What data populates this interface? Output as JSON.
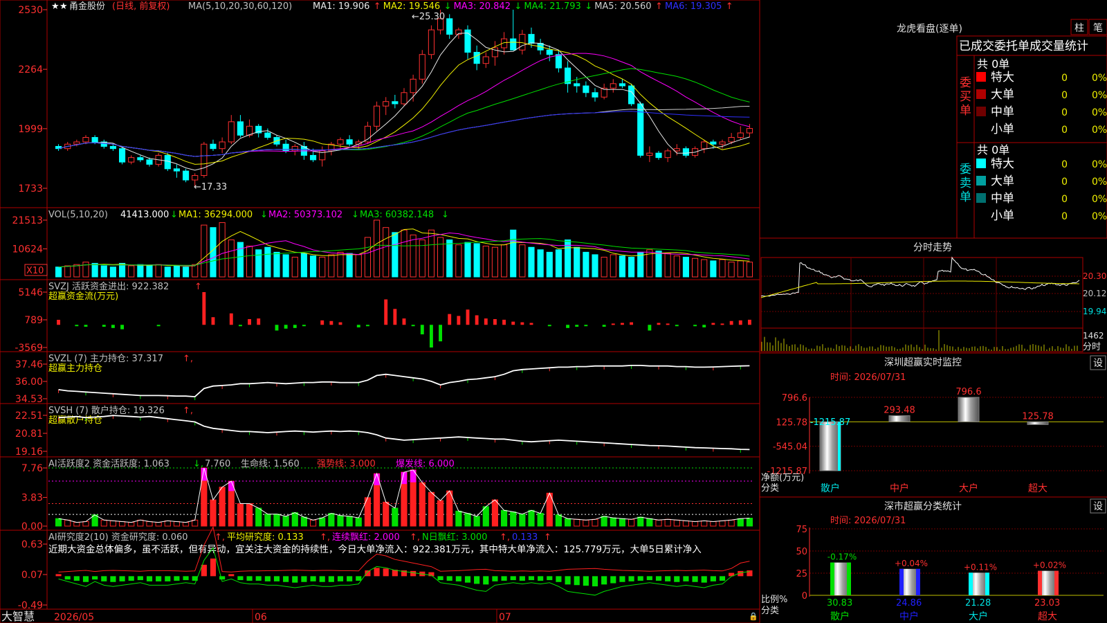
{
  "header": {
    "stock_name": "甬金股份",
    "mode": "(日线, 前复权)",
    "ma_label": "MA(5,10,20,30,60,120)",
    "ma_values": [
      {
        "label": "MA1: 19.906",
        "arrow": "↑",
        "color": "#e8e8e8"
      },
      {
        "label": "MA2: 19.546",
        "arrow": "↓",
        "color": "#f0f000"
      },
      {
        "label": "MA3: 20.842",
        "arrow": "↓",
        "color": "#ff00ff"
      },
      {
        "label": "MA4: 21.793",
        "arrow": "↓",
        "color": "#00e000"
      },
      {
        "label": "MA5: 20.560",
        "arrow": "↑",
        "color": "#d0d0d0"
      },
      {
        "label": "MA6: 19.305",
        "arrow": "↑",
        "color": "#3030ff"
      }
    ]
  },
  "price_axis": [
    "2530",
    "2264",
    "1999",
    "1733"
  ],
  "annotations": {
    "high": "25.30",
    "low": "17.33"
  },
  "vol_panel": {
    "title": "VOL(5,10,20)",
    "value": "41413.000",
    "ma1": "MA1: 36294.000",
    "ma2": "MA2: 50373.102",
    "ma3": "MA3: 60382.148",
    "axis": [
      "21513",
      "10624"
    ],
    "unit": "X10"
  },
  "svzj_panel": {
    "title": "SVZJ  活跃资金进出: 922.382",
    "subtitle": "超赢资金流(万元)",
    "axis": [
      "5146",
      "789",
      "-3569"
    ]
  },
  "svzl_panel": {
    "title": "SVZL (7) 主力持仓: 37.317",
    "subtitle": "超赢主力持仓",
    "axis": [
      "37.46",
      "36.00",
      "34.53"
    ]
  },
  "svsh_panel": {
    "title": "SVSH (7) 散户持仓: 19.326",
    "subtitle": "超赢散户持仓",
    "axis": [
      "22.51",
      "20.81",
      "19.16"
    ]
  },
  "ai_panel": {
    "title": "AI活跃度2 资金活跃度: 1.063",
    "v2": "7.760",
    "life": "生命线: 1.560",
    "strong": "强势线: 3.000",
    "burst": "爆发线: 6.000",
    "axis": [
      "7.76",
      "3.83",
      "0.00"
    ]
  },
  "research_panel": {
    "title": "AI研究度2(10) 资金研究度: 0.060",
    "avg": "平均研究度: 0.133",
    "red": "连续飘红: 2.000",
    "nred": "N日飘红: 3.000",
    "last": "0.133",
    "text": "近期大资金总体偏多，虽不活跃，但有异动，宜关注大资金的持续性，今日大单净流入：922.381万元，其中特大单净流入：125.779万元，大单5日累计净入",
    "axis": [
      "0.63",
      "0.07",
      "-0.49"
    ]
  },
  "footer": {
    "brand": "大智慧",
    "dates": [
      "2026/05",
      "06",
      "07"
    ]
  },
  "right": {
    "lhb_title": "龙虎看盘(逐单)",
    "btn_bar": "柱",
    "btn_pen": "笔",
    "trade_header": "已成交委托单成交量统计",
    "buy_label": "委买单",
    "sell_label": "委卖单",
    "buy_total": "共 0单",
    "sell_total": "共 0单",
    "rows": [
      "特大",
      "大单",
      "中单",
      "小单"
    ],
    "zero": "0",
    "pct": "0%",
    "fenshi_title": "分时走势",
    "fenshi_axis": [
      "20.30",
      "20.12",
      "19.94"
    ],
    "fenshi_vol": "1462",
    "fenshi_unit": "分时",
    "sz_title": "深圳超赢实时监控",
    "sz_setting": "设",
    "sz_time": "时间: 2026/07/31",
    "sz_axis": [
      "796.6",
      "125.78",
      "-545.04",
      "-1215.87"
    ],
    "sz_ylabel": "净额(万元)",
    "sz_xlabel": "分类",
    "sz_categories": [
      "散户",
      "中户",
      "大户",
      "超大"
    ],
    "sz_values": [
      "-1215.87",
      "293.48",
      "796.6",
      "125.78"
    ],
    "ss_title": "深市超赢分类统计",
    "ss_setting": "设",
    "ss_time": "时间: 2026/07/31",
    "ss_axis": [
      "75",
      "50",
      "25",
      "0"
    ],
    "ss_ylabel": "比例%",
    "ss_xlabel": "分类",
    "ss_categories": [
      "散户",
      "中户",
      "大户",
      "超大"
    ],
    "ss_changes": [
      "-0.17%",
      "+0.04%",
      "+0.11%",
      "+0.02%"
    ],
    "ss_values": [
      "30.83",
      "24.86",
      "21.28",
      "23.03"
    ]
  },
  "chart_data": [
    {
      "type": "candlestick",
      "title": "甬金股份 (日线, 前复权)",
      "ylim": [
        17.33,
        25.3
      ],
      "ohlc": [
        [
          19.2,
          19.3,
          19.0,
          19.1
        ],
        [
          19.1,
          19.4,
          19.0,
          19.3
        ],
        [
          19.3,
          19.5,
          19.2,
          19.4
        ],
        [
          19.4,
          19.7,
          19.3,
          19.6
        ],
        [
          19.6,
          19.7,
          19.3,
          19.4
        ],
        [
          19.4,
          19.5,
          19.1,
          19.2
        ],
        [
          19.2,
          19.3,
          19.0,
          19.1
        ],
        [
          19.1,
          19.2,
          18.4,
          18.5
        ],
        [
          18.5,
          18.8,
          18.4,
          18.7
        ],
        [
          18.7,
          18.8,
          18.5,
          18.6
        ],
        [
          18.6,
          18.7,
          18.3,
          18.4
        ],
        [
          18.4,
          18.9,
          18.3,
          18.8
        ],
        [
          18.8,
          18.9,
          18.1,
          18.2
        ],
        [
          18.2,
          18.4,
          17.8,
          18.1
        ],
        [
          18.1,
          18.2,
          17.6,
          17.7
        ],
        [
          17.7,
          18.0,
          17.4,
          17.9
        ],
        [
          17.9,
          19.4,
          17.8,
          19.3
        ],
        [
          19.3,
          19.5,
          19.0,
          19.1
        ],
        [
          19.1,
          19.6,
          18.9,
          19.4
        ],
        [
          19.4,
          20.6,
          19.3,
          20.3
        ],
        [
          20.3,
          20.6,
          19.6,
          19.7
        ],
        [
          19.7,
          20.4,
          19.6,
          20.1
        ],
        [
          20.1,
          20.2,
          19.6,
          19.8
        ],
        [
          19.8,
          20.0,
          19.5,
          19.6
        ],
        [
          19.6,
          19.7,
          19.2,
          19.3
        ],
        [
          19.3,
          19.5,
          18.9,
          19.0
        ],
        [
          19.0,
          19.3,
          18.8,
          19.2
        ],
        [
          19.2,
          19.4,
          18.6,
          18.8
        ],
        [
          18.8,
          19.1,
          18.5,
          18.6
        ],
        [
          18.6,
          19.2,
          18.3,
          19.0
        ],
        [
          19.0,
          19.4,
          18.8,
          19.3
        ],
        [
          19.3,
          19.6,
          19.1,
          19.5
        ],
        [
          19.5,
          19.7,
          19.2,
          19.3
        ],
        [
          19.3,
          19.5,
          19.1,
          19.4
        ],
        [
          19.4,
          20.3,
          19.3,
          20.1
        ],
        [
          20.1,
          21.2,
          19.9,
          21.0
        ],
        [
          21.0,
          21.4,
          20.6,
          21.2
        ],
        [
          21.2,
          21.5,
          20.9,
          21.1
        ],
        [
          21.1,
          21.8,
          21.0,
          21.6
        ],
        [
          21.6,
          22.4,
          21.2,
          22.2
        ],
        [
          22.2,
          23.5,
          22.0,
          23.3
        ],
        [
          23.3,
          24.6,
          23.1,
          24.4
        ],
        [
          24.4,
          25.3,
          24.2,
          24.9
        ],
        [
          24.9,
          25.1,
          24.0,
          24.2
        ],
        [
          24.2,
          24.5,
          24.0,
          24.4
        ],
        [
          24.4,
          24.6,
          23.1,
          23.4
        ],
        [
          23.4,
          23.7,
          22.6,
          22.9
        ],
        [
          22.9,
          23.4,
          22.7,
          23.2
        ],
        [
          23.2,
          23.9,
          22.8,
          23.6
        ],
        [
          23.6,
          24.3,
          23.3,
          24.0
        ],
        [
          24.0,
          25.3,
          23.7,
          23.5
        ],
        [
          23.5,
          24.4,
          23.3,
          24.2
        ],
        [
          24.2,
          24.5,
          23.6,
          23.8
        ],
        [
          23.8,
          24.0,
          23.3,
          23.5
        ],
        [
          23.5,
          23.7,
          23.0,
          23.3
        ],
        [
          23.3,
          23.5,
          22.5,
          22.7
        ],
        [
          22.7,
          23.0,
          21.6,
          22.0
        ],
        [
          22.0,
          22.3,
          21.6,
          21.9
        ],
        [
          21.9,
          22.1,
          21.4,
          21.6
        ],
        [
          21.6,
          21.8,
          21.2,
          21.4
        ],
        [
          21.4,
          22.0,
          21.3,
          21.8
        ],
        [
          21.8,
          22.2,
          21.6,
          22.0
        ],
        [
          22.0,
          22.2,
          21.8,
          21.9
        ],
        [
          21.9,
          22.0,
          21.0,
          21.1
        ],
        [
          21.1,
          21.2,
          18.7,
          18.8
        ],
        [
          18.8,
          19.2,
          18.5,
          18.9
        ],
        [
          18.9,
          19.0,
          18.6,
          18.7
        ],
        [
          18.7,
          19.1,
          18.5,
          19.0
        ],
        [
          19.0,
          19.3,
          18.8,
          19.1
        ],
        [
          19.1,
          19.2,
          18.7,
          18.8
        ],
        [
          18.8,
          19.2,
          18.7,
          19.1
        ],
        [
          19.1,
          19.5,
          18.9,
          19.4
        ],
        [
          19.4,
          19.5,
          19.1,
          19.3
        ],
        [
          19.3,
          19.5,
          19.1,
          19.4
        ],
        [
          19.4,
          19.8,
          19.3,
          19.6
        ],
        [
          19.6,
          20.1,
          19.5,
          19.8
        ],
        [
          19.8,
          20.2,
          19.6,
          20.0
        ]
      ]
    },
    {
      "type": "bar",
      "title": "VOL(5,10,20)",
      "values": [
        8,
        9,
        10,
        12,
        11,
        9,
        8,
        11,
        9,
        10,
        9,
        10,
        8,
        9,
        8,
        10,
        42,
        40,
        44,
        30,
        28,
        25,
        22,
        24,
        20,
        18,
        16,
        19,
        17,
        16,
        18,
        20,
        19,
        18,
        32,
        46,
        40,
        36,
        38,
        34,
        30,
        38,
        32,
        30,
        26,
        28,
        27,
        25,
        24,
        26,
        38,
        26,
        24,
        22,
        20,
        22,
        30,
        24,
        20,
        18,
        16,
        18,
        17,
        16,
        20,
        22,
        21,
        19,
        17,
        16,
        15,
        14,
        13,
        14,
        12,
        13,
        12
      ]
    },
    {
      "type": "bar",
      "title": "超赢资金流(万元)",
      "values": [
        789,
        0,
        -200,
        -300,
        0,
        -300,
        -500,
        -700,
        0,
        -100,
        0,
        -200,
        0,
        -100,
        0,
        0,
        5146,
        1200,
        -100,
        1800,
        -200,
        900,
        1000,
        -100,
        -900,
        -600,
        -500,
        -200,
        0,
        700,
        600,
        400,
        -100,
        -400,
        -200,
        0,
        4000,
        2500,
        1000,
        -200,
        -1500,
        -3569,
        -2600,
        1700,
        1400,
        2400,
        1500,
        1000,
        900,
        800,
        500,
        400,
        300,
        -100,
        -200,
        0,
        -500,
        -300,
        -200,
        -100,
        -300,
        200,
        300,
        400,
        100,
        -900,
        300,
        200,
        -200,
        100,
        -200,
        -400,
        300,
        200,
        600,
        700,
        800
      ]
    },
    {
      "type": "line",
      "title": "超赢主力持仓",
      "ylim": [
        34.53,
        37.46
      ],
      "values": [
        35.3,
        35.2,
        35.15,
        35.1,
        35.05,
        35.0,
        34.95,
        34.9,
        34.85,
        34.8,
        34.8,
        34.8,
        34.78,
        34.75,
        34.75,
        34.7,
        35.4,
        35.6,
        35.65,
        35.7,
        35.8,
        35.8,
        35.85,
        35.9,
        35.85,
        35.8,
        35.85,
        35.9,
        35.9,
        35.95,
        35.95,
        35.9,
        35.9,
        35.9,
        36.1,
        36.5,
        36.6,
        36.5,
        36.4,
        36.3,
        36.2,
        36.0,
        35.7,
        35.9,
        36.0,
        36.15,
        36.2,
        36.3,
        36.4,
        36.6,
        36.9,
        37.0,
        37.05,
        37.1,
        37.15,
        37.2,
        37.2,
        37.25,
        37.25,
        37.3,
        37.3,
        37.3,
        37.3,
        37.35,
        37.35,
        37.3,
        37.3,
        37.3,
        37.25,
        37.25,
        37.2,
        37.2,
        37.22,
        37.25,
        37.28,
        37.3,
        37.317
      ]
    },
    {
      "type": "line",
      "title": "超赢散户持仓",
      "ylim": [
        19.16,
        22.51
      ],
      "values": [
        22.3,
        22.35,
        22.4,
        22.3,
        22.35,
        22.4,
        22.5,
        22.45,
        22.4,
        22.35,
        22.4,
        22.3,
        22.2,
        22.1,
        22.0,
        21.9,
        21.5,
        21.3,
        21.2,
        21.1,
        21.0,
        21.0,
        20.95,
        20.9,
        20.95,
        21.0,
        21.05,
        21.0,
        20.95,
        21.0,
        21.05,
        21.0,
        21.05,
        21.0,
        20.9,
        20.7,
        20.4,
        20.3,
        20.2,
        20.25,
        20.3,
        20.35,
        20.4,
        20.45,
        20.5,
        20.45,
        20.4,
        20.35,
        20.3,
        20.3,
        20.2,
        20.1,
        20.05,
        20.1,
        20.15,
        20.2,
        20.15,
        20.1,
        20.05,
        20.0,
        19.95,
        19.9,
        19.85,
        19.8,
        19.75,
        19.7,
        19.68,
        19.65,
        19.6,
        19.55,
        19.5,
        19.48,
        19.45,
        19.42,
        19.4,
        19.35,
        19.326
      ]
    },
    {
      "type": "bar",
      "title": "AI活跃度2",
      "ylim": [
        0,
        7.76
      ],
      "values": [
        1.0,
        0.8,
        0.5,
        0.6,
        1.5,
        0.8,
        0.7,
        0.6,
        0.5,
        0.8,
        0.6,
        0.5,
        0.7,
        0.6,
        0.5,
        0.8,
        7.76,
        3.5,
        5.2,
        6.0,
        3.0,
        3.0,
        2.4,
        1.6,
        1.6,
        1.3,
        1.8,
        1.2,
        0.8,
        1.1,
        1.7,
        1.4,
        1.3,
        1.1,
        3.8,
        7.0,
        3.2,
        2.4,
        7.2,
        7.5,
        5.8,
        4.5,
        3.4,
        4.7,
        2.0,
        1.7,
        1.3,
        2.6,
        3.5,
        2.1,
        1.9,
        1.6,
        2.1,
        1.7,
        4.4,
        1.5,
        1.0,
        0.9,
        0.8,
        0.9,
        1.3,
        1.1,
        1.0,
        0.9,
        1.2,
        1.0,
        0.8,
        0.9,
        0.8,
        0.7,
        0.6,
        0.7,
        0.6,
        0.7,
        0.8,
        1.0,
        1.063
      ]
    },
    {
      "type": "bar",
      "title": "AI研究度2(10)",
      "ylim": [
        -0.49,
        0.63
      ],
      "values": [
        0.0,
        -0.02,
        -0.04,
        -0.06,
        -0.02,
        -0.05,
        -0.06,
        -0.05,
        -0.04,
        -0.03,
        -0.05,
        -0.05,
        -0.05,
        -0.04,
        -0.03,
        -0.04,
        0.15,
        0.25,
        -0.02,
        0.0,
        -0.03,
        -0.04,
        -0.04,
        -0.05,
        -0.05,
        -0.06,
        -0.07,
        -0.06,
        -0.05,
        -0.06,
        -0.06,
        -0.05,
        -0.05,
        -0.04,
        0.06,
        0.1,
        0.09,
        0.07,
        0.06,
        0.05,
        0.04,
        0.03,
        -0.03,
        -0.04,
        -0.05,
        -0.07,
        -0.09,
        -0.1,
        -0.05,
        -0.04,
        -0.03,
        -0.04,
        -0.03,
        -0.04,
        -0.03,
        -0.06,
        -0.1,
        -0.11,
        -0.12,
        -0.13,
        -0.1,
        -0.08,
        -0.06,
        -0.05,
        -0.04,
        -0.03,
        -0.04,
        -0.05,
        -0.06,
        -0.05,
        -0.06,
        -0.07,
        -0.05,
        -0.04,
        0.02,
        0.05,
        0.06
      ]
    },
    {
      "type": "bar",
      "title": "深圳超赢实时监控",
      "categories": [
        "散户",
        "中户",
        "大户",
        "超大"
      ],
      "values": [
        -1215.87,
        293.48,
        796.6,
        125.78
      ],
      "ylim": [
        -1215.87,
        796.6
      ],
      "ylabel": "净额(万元)",
      "xlabel": "分类"
    },
    {
      "type": "bar",
      "title": "深市超赢分类统计",
      "categories": [
        "散户",
        "中户",
        "大户",
        "超大"
      ],
      "values": [
        30.83,
        24.86,
        21.28,
        23.03
      ],
      "ylim": [
        0,
        75
      ],
      "ylabel": "比例%",
      "xlabel": "分类"
    }
  ]
}
